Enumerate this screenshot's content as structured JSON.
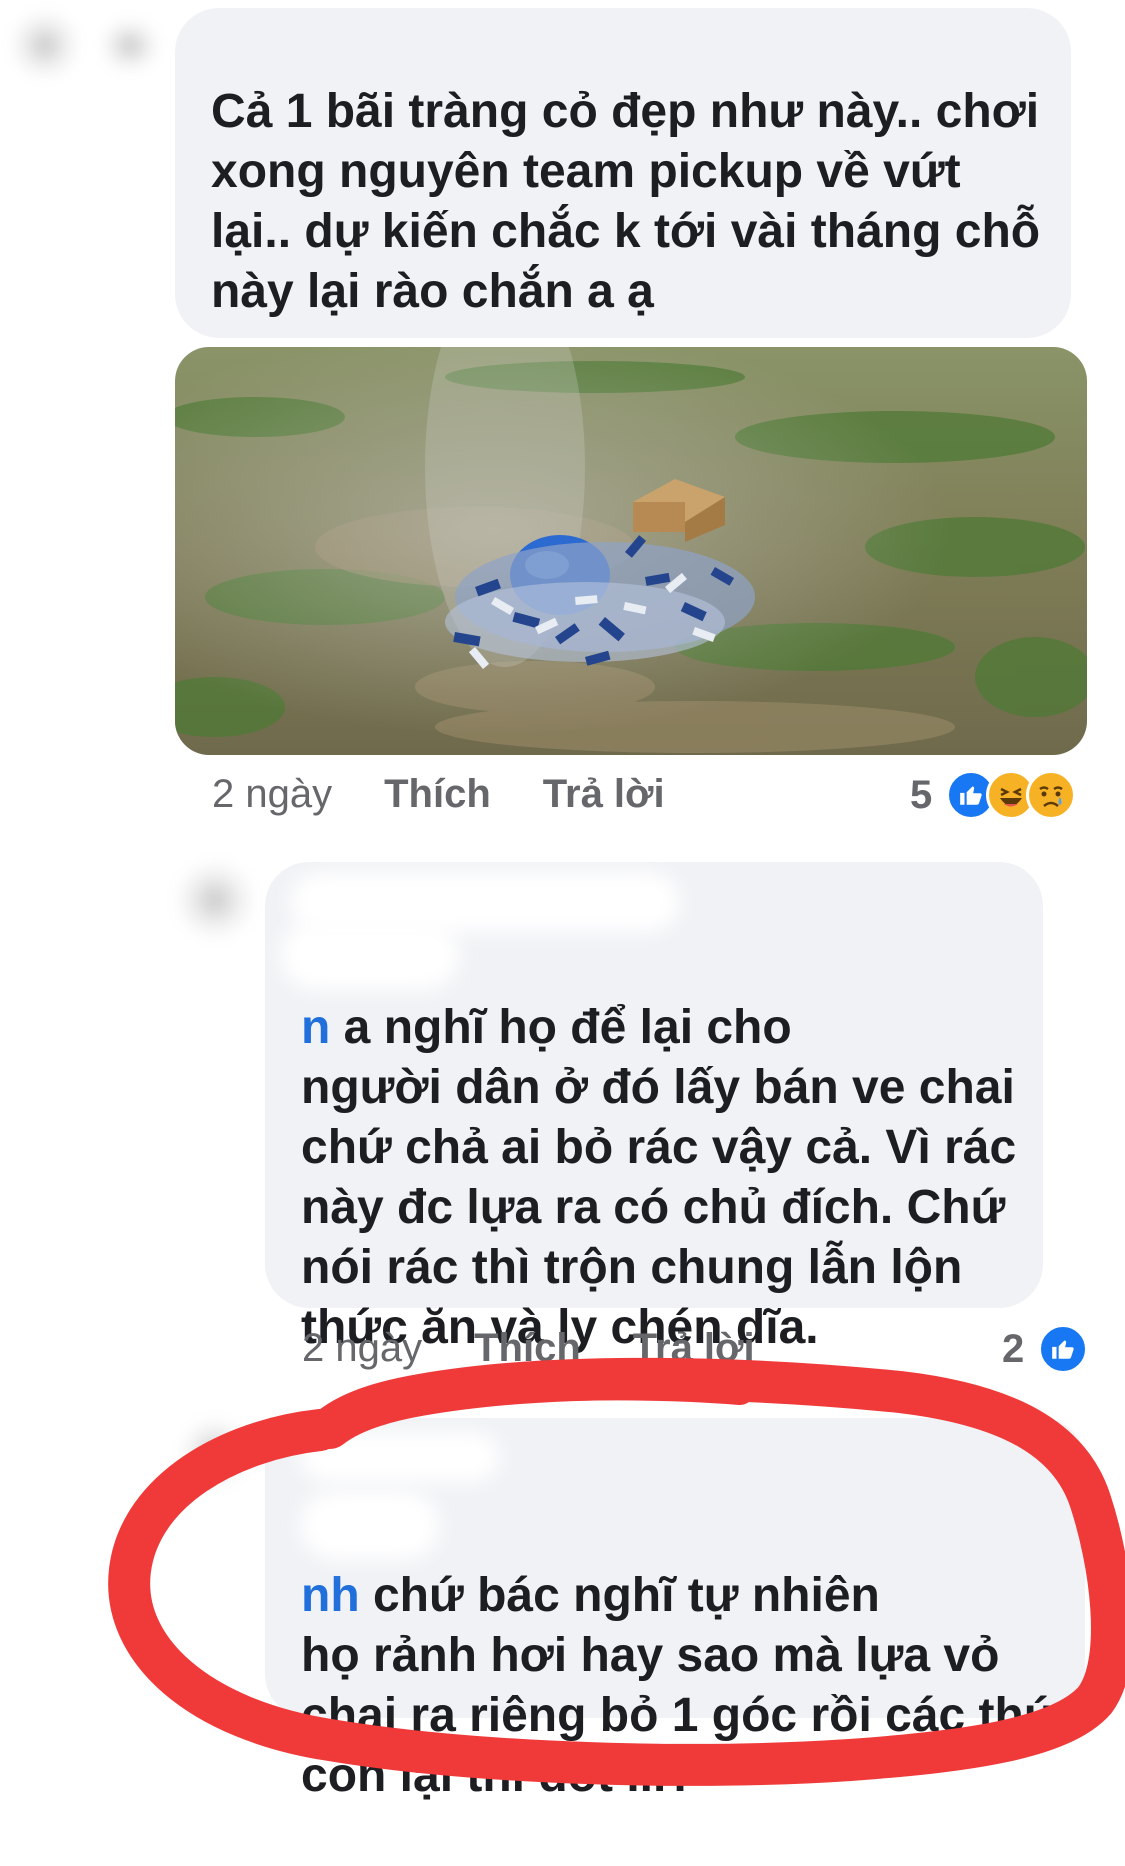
{
  "comments": [
    {
      "text": "Cả 1 bãi tràng cỏ đẹp như này.. chơi\nxong nguyên team pickup về vứt\nlại.. dự kiến chắc k tới vài tháng chỗ\nnày lại rào chắn a ạ",
      "time": "2 ngày",
      "like_label": "Thích",
      "reply_label": "Trả lời",
      "reaction_count": "5",
      "reactions": [
        "like-icon",
        "haha-icon",
        "sad-icon"
      ]
    },
    {
      "mention_tail": "n",
      "text_first_line": " a nghĩ họ để lại cho",
      "text_rest": "người dân ở đó lấy bán ve chai\nchứ chả ai bỏ rác vậy cả. Vì rác\nnày đc lựa ra có chủ đích. Chứ\nnói rác thì trộn chung lẫn lộn\nthức ăn và ly chén dĩa.",
      "time": "2 ngày",
      "like_label": "Thích",
      "reply_label": "Trả lời",
      "reaction_count": "2",
      "reactions": [
        "like-icon"
      ]
    },
    {
      "mention_tail": "nh",
      "text_first_line": " chứ bác nghĩ tự nhiên",
      "text_rest": "họ rảnh hơi hay sao mà lựa vỏ\nchai ra riêng bỏ 1 góc rồi các thứ\ncòn lại thì đốt ...?"
    }
  ],
  "colors": {
    "bubble": "#f0f2f5",
    "meta": "#65676b",
    "mention": "#216fdb",
    "circle_annotation": "#f03a3a",
    "like_blue": "#1877f2"
  }
}
